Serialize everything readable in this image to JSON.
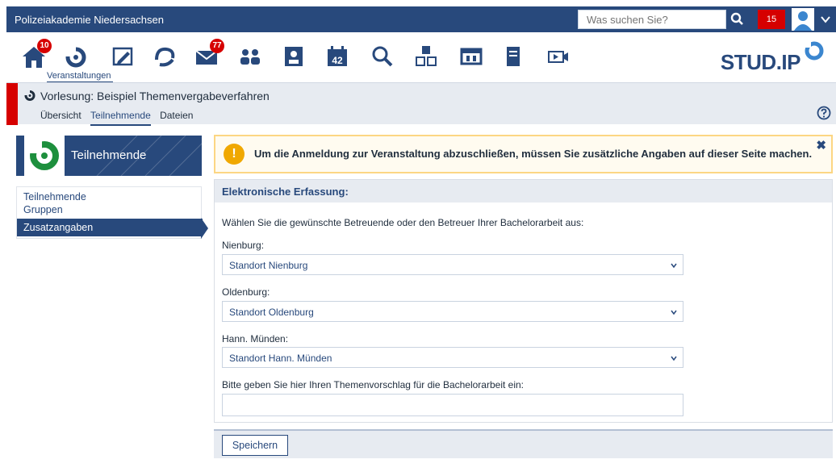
{
  "header": {
    "brand": "Polizeiakademie Niedersachsen",
    "search_placeholder": "Was suchen Sie?",
    "notifications": "15"
  },
  "nav": {
    "items": [
      {
        "name": "start",
        "badge": "10"
      },
      {
        "name": "veranstaltungen",
        "label": "Veranstaltungen"
      },
      {
        "name": "arbeitsplatz"
      },
      {
        "name": "community"
      },
      {
        "name": "nachrichten",
        "badge": "77"
      },
      {
        "name": "gruppen"
      },
      {
        "name": "profil"
      },
      {
        "name": "planer",
        "calendar_day": "42"
      },
      {
        "name": "suche"
      },
      {
        "name": "tools"
      },
      {
        "name": "admin"
      },
      {
        "name": "dokumente"
      },
      {
        "name": "medien"
      }
    ],
    "logo": "STUD.IP"
  },
  "context": {
    "course_title": "Vorlesung: Beispiel Themenvergabeverfahren",
    "tabs": [
      "Übersicht",
      "Teilnehmende",
      "Dateien"
    ],
    "active_tab": "Teilnehmende"
  },
  "sidebar": {
    "title": "Teilnehmende",
    "links": [
      "Teilnehmende",
      "Gruppen",
      "Zusatzangaben"
    ],
    "active": "Zusatzangaben"
  },
  "message": {
    "text": "Um die Anmeldung zur Veranstaltung abzuschließen, müssen Sie zusätzliche Angaben auf dieser Seite machen.",
    "warn_glyph": "!",
    "close_glyph": "✖"
  },
  "form": {
    "heading": "Elektronische Erfassung:",
    "intro": "Wählen Sie die gewünschte Betreuende oder den Betreuer Ihrer Bachelorarbeit aus:",
    "fields": [
      {
        "label": "Nienburg:",
        "value": "Standort Nienburg"
      },
      {
        "label": "Oldenburg:",
        "value": "Standort Oldenburg"
      },
      {
        "label": "Hann. Münden:",
        "value": "Standort Hann. Münden"
      }
    ],
    "topic_label": "Bitte geben Sie hier Ihren Themenvorschlag für die Bachelorarbeit ein:",
    "topic_value": ""
  },
  "footer": {
    "save_label": "Speichern"
  },
  "colors": {
    "primary": "#28497c",
    "alert": "#d60000",
    "warning": "#f0a800"
  }
}
